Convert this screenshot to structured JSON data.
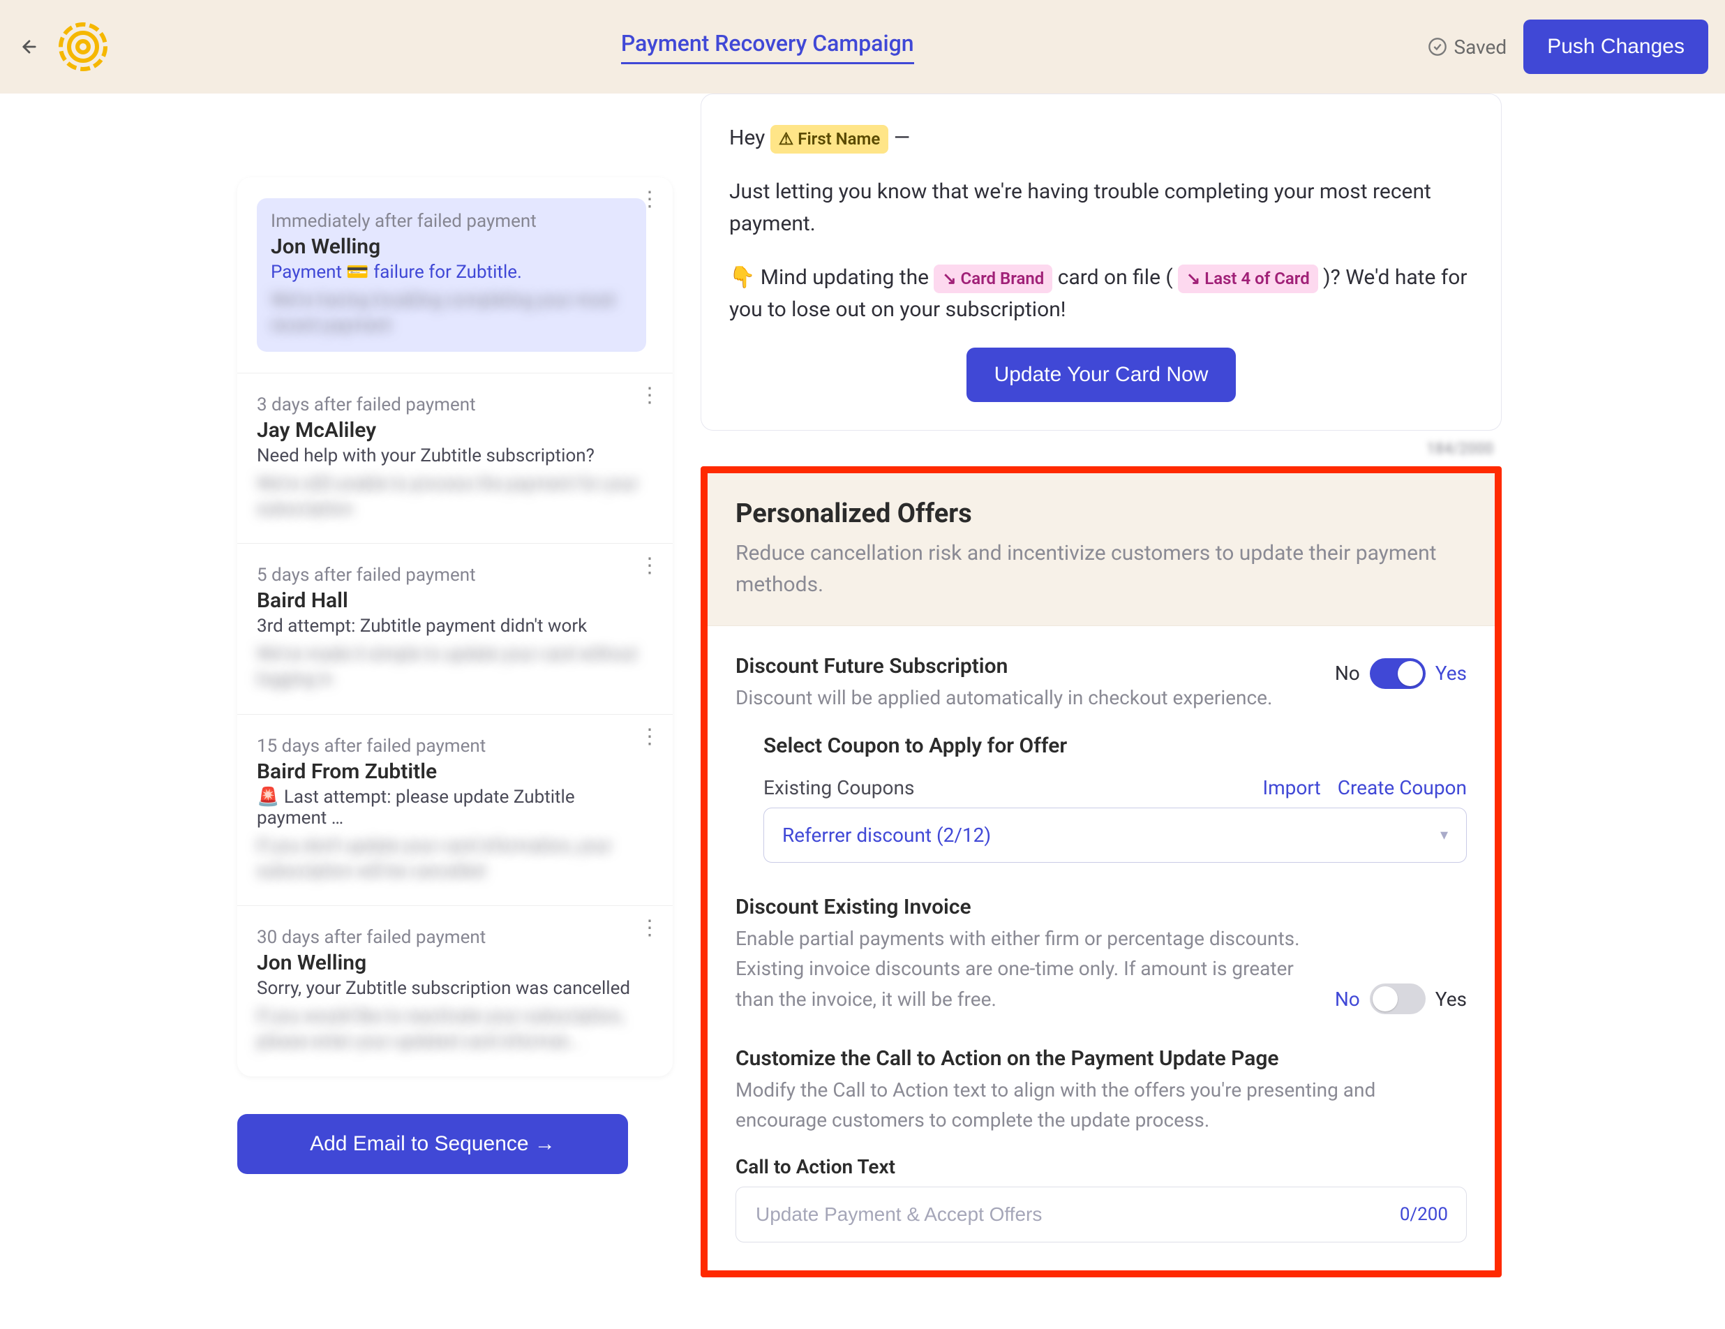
{
  "header": {
    "title": "Payment Recovery Campaign",
    "saved_label": "Saved",
    "push_label": "Push Changes"
  },
  "sequence": {
    "items": [
      {
        "num": "1",
        "selected": true,
        "timing": "Immediately after failed payment",
        "from": "Jon Welling",
        "subject_prefix": "Payment ",
        "subject_suffix": " failure for Zubtitle.",
        "card_emoji": "💳",
        "blur1": "We're having troubling completing your most",
        "blur2": "recent payment"
      },
      {
        "num": "2",
        "selected": false,
        "timing": "3 days after failed payment",
        "from": "Jay McAliley",
        "subject": "Need help with your Zubtitle subscription?",
        "blur1": "We're still unable to process the payment for your",
        "blur2": "subscription"
      },
      {
        "num": "3",
        "selected": false,
        "timing": "5 days after failed payment",
        "from": "Baird Hall",
        "subject": "3rd attempt: Zubtitle payment didn't work",
        "blur1": "We've made it simple to update your card without",
        "blur2": "logging in"
      },
      {
        "num": "4",
        "selected": false,
        "timing": "15 days after failed payment",
        "from": "Baird From Zubtitle",
        "subject": "🚨 Last attempt: please update Zubtitle payment …",
        "blur1": "If you don't update your card information, your",
        "blur2": "subscription will be cancelled"
      },
      {
        "num": "5",
        "selected": false,
        "timing": "30 days after failed payment",
        "from": "Jon Welling",
        "subject": "Sorry, your Zubtitle subscription was cancelled",
        "blur1": "If you would like to reactivate your subscription,",
        "blur2": "please enter your updated card informat..."
      }
    ],
    "add_label": "Add Email to Sequence →"
  },
  "email": {
    "greet_prefix": "Hey ",
    "greet_chip": "⚠ First Name",
    "greet_suffix": " —",
    "para1": "Just letting you know that we're having trouble completing your most recent payment.",
    "line2_prefix": "👇 Mind updating the ",
    "chip_card_brand": "↘ Card Brand",
    "line2_mid": " card on file ( ",
    "chip_last4": "↘ Last 4 of Card",
    "line2_suffix": " )? We'd hate for you to lose out on your subscription!",
    "cta": "Update Your Card Now",
    "counter_blur": "184/2000"
  },
  "offers": {
    "title": "Personalized Offers",
    "subtitle": "Reduce cancellation risk and incentivize customers to update their payment methods.",
    "discount_future": {
      "title": "Discount Future Subscription",
      "desc": "Discount will be applied automatically in checkout experience.",
      "no": "No",
      "yes": "Yes",
      "on": true
    },
    "coupon": {
      "heading": "Select Coupon to Apply for Offer",
      "label": "Existing Coupons",
      "import": "Import",
      "create": "Create Coupon",
      "selected": "Referrer discount (2/12)"
    },
    "discount_invoice": {
      "title": "Discount Existing Invoice",
      "desc": "Enable partial payments with either firm or percentage discounts.\nExisting invoice discounts are one-time only. If amount is greater than the invoice, it will be free.",
      "no": "No",
      "yes": "Yes",
      "on": false
    },
    "cta": {
      "title": "Customize the Call to Action on the Payment Update Page",
      "desc": "Modify the Call to Action text to align with the offers you're presenting and encourage customers to complete the update process.",
      "label": "Call to Action Text",
      "placeholder": "Update Payment & Accept Offers",
      "counter": "0/200"
    }
  }
}
